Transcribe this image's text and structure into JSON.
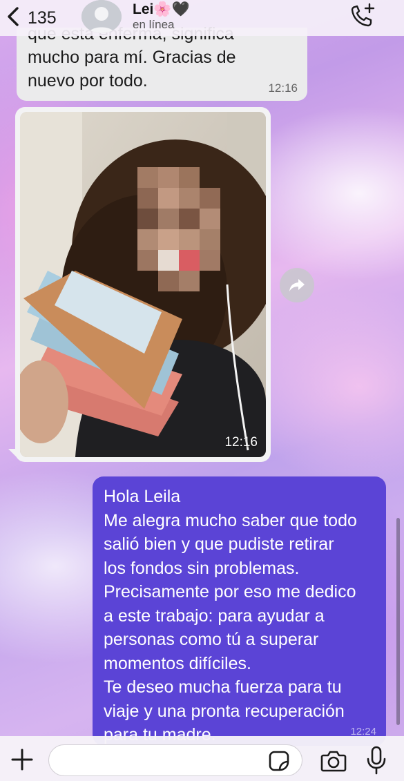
{
  "header": {
    "back_count": "135",
    "contact_name": "Lei🌸🖤",
    "status": "en línea"
  },
  "messages": {
    "incoming_text": {
      "lines": [
        "que está enferma, significa",
        "mucho para mí. Gracias de",
        "nuevo por todo."
      ],
      "time": "12:16"
    },
    "incoming_photo": {
      "time": "12:16"
    },
    "outgoing_text": {
      "lines": [
        "Hola Leila",
        "Me alegra mucho saber que todo",
        "salió bien y que pudiste retirar",
        "los fondos sin problemas.",
        "Precisamente por eso me dedico",
        "a este trabajo: para ayudar a",
        "personas como tú a superar",
        "momentos difíciles.",
        "Te deseo mucha fuerza para tu",
        "viaje y una pronta recuperación",
        "para tu madre."
      ],
      "time": "12:24"
    }
  },
  "composer": {
    "placeholder": ""
  },
  "icons": {
    "back": "chevron-left-icon",
    "avatar": "person-silhouette-icon",
    "call": "phone-plus-icon",
    "forward": "share-arrow-icon",
    "plus": "plus-icon",
    "sticker": "sticker-icon",
    "camera": "camera-icon",
    "mic": "microphone-icon"
  },
  "colors": {
    "outgoing_bubble": "#5b44d6",
    "incoming_bubble": "#ebebec"
  }
}
